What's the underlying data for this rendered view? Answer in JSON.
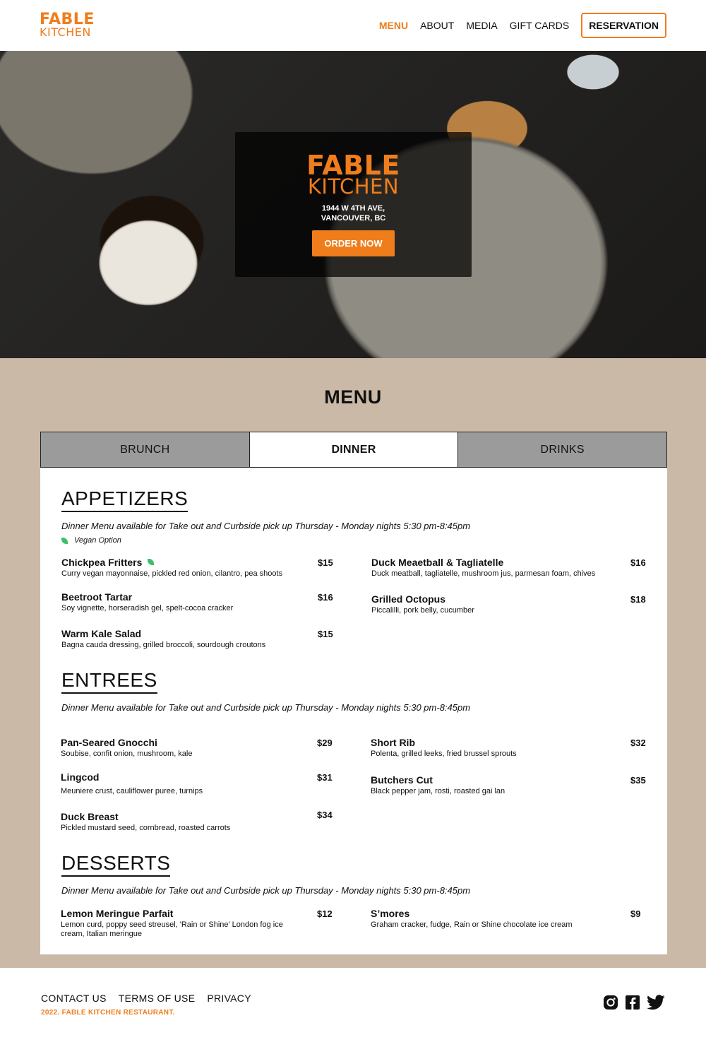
{
  "brand": {
    "line1": "FABLE",
    "line2": "KITCHEN",
    "accent_color": "#f07d1c"
  },
  "nav": {
    "items": [
      "MENU",
      "ABOUT",
      "MEDIA",
      "GIFT CARDS"
    ],
    "reservation_label": "RESERVATION"
  },
  "hero": {
    "logo_line1": "FABLE",
    "logo_line2": "KITCHEN",
    "address_line1": "1944 W 4TH AVE,",
    "address_line2": "VANCOUVER, BC",
    "cta_label": "ORDER NOW"
  },
  "menu": {
    "heading": "MENU",
    "tabs": [
      "BRUNCH",
      "DINNER",
      "DRINKS"
    ],
    "active_tab": "DINNER",
    "background_color": "#cbb9a8",
    "sections": [
      {
        "title": "APPETIZERS",
        "note": "Dinner Menu available for Take out and Curbside pick up Thursday - Monday nights 5:30 pm-8:45pm",
        "legend": "Vegan Option",
        "items": [
          {
            "name": "Chickpea Fritters",
            "desc": "Curry vegan mayonnaise, pickled red onion, cilantro, pea shoots",
            "price": "$15",
            "vegan": true
          },
          {
            "name": "Beetroot Tartar",
            "desc": "Soy vignette, horseradish gel, spelt-cocoa cracker",
            "price": "$16"
          },
          {
            "name": "Warm Kale Salad",
            "desc": "Bagna cauda dressing, grilled broccoli, sourdough croutons",
            "price": "$15"
          },
          {
            "name": "Duck Meaetball & Tagliatelle",
            "desc": "Duck meatball, tagliatelle, mushroom jus, parmesan foam, chives",
            "price": "$16"
          },
          {
            "name": "Grilled Octopus",
            "desc": "Piccalilli, pork belly, cucumber",
            "price": "$18"
          }
        ]
      },
      {
        "title": "ENTREES",
        "note": "Dinner Menu available for Take out and Curbside pick up Thursday - Monday nights 5:30 pm-8:45pm",
        "items": [
          {
            "name": "Pan-Seared Gnocchi",
            "desc": "Soubise, confit onion, mushroom, kale",
            "price": "$29"
          },
          {
            "name": "Lingcod",
            "desc": "Meuniere crust, cauliflower puree, turnips",
            "price": "$31"
          },
          {
            "name": "Duck Breast",
            "desc": "Pickled mustard seed, cornbread, roasted carrots",
            "price": "$34"
          },
          {
            "name": "Short Rib",
            "desc": "Polenta, grilled leeks, fried brussel sprouts",
            "price": "$32"
          },
          {
            "name": "Butchers Cut",
            "desc": "Black pepper jam, rosti, roasted gai lan",
            "price": "$35"
          }
        ]
      },
      {
        "title": "DESSERTS",
        "note": "Dinner Menu available for Take out and Curbside pick up Thursday - Monday nights 5:30 pm-8:45pm",
        "items": [
          {
            "name": "Lemon Meringue Parfait",
            "desc": "Lemon curd, poppy seed streusel, 'Rain or Shine' London fog ice cream, Italian meringue",
            "price": "$12"
          },
          {
            "name": "S’mores",
            "desc": "Graham cracker, fudge, Rain or Shine chocolate ice cream",
            "price": "$9"
          }
        ]
      }
    ]
  },
  "footer": {
    "links": [
      "CONTACT US",
      "TERMS OF USE",
      "PRIVACY"
    ],
    "copyright": "2022. FABLE KITCHEN RESTAURANT.",
    "social_icons": [
      "instagram-icon",
      "facebook-icon",
      "twitter-icon"
    ]
  }
}
